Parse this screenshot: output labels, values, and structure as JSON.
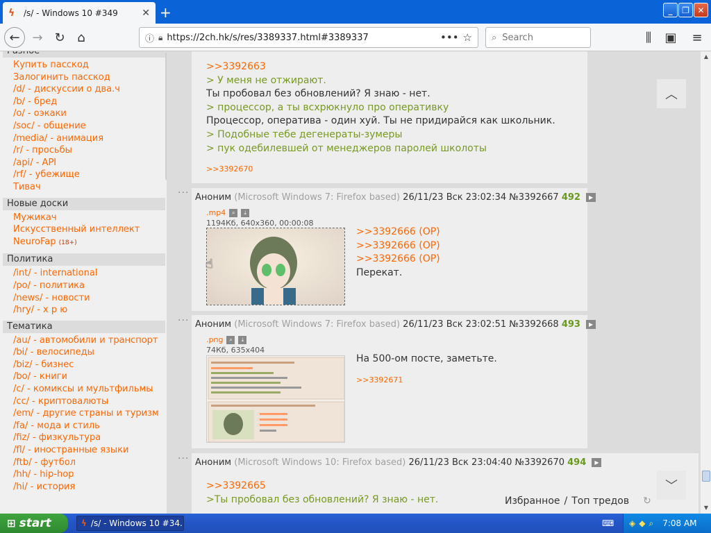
{
  "browser": {
    "tab_title": "/s/ - Windows 10 #349",
    "tab_close": "✕",
    "new_tab": "+",
    "url": "https://2ch.hk/s/res/3389337.html#3389337",
    "search_placeholder": "Search",
    "window_min": "_",
    "window_max": "❐",
    "window_close": "✕"
  },
  "sidebar": {
    "sections": [
      {
        "title": "Разное",
        "items": [
          "Купить пасскод",
          "Залогинить пасскод",
          "/d/ - дискуссии о два.ч",
          "/b/ - бред",
          "/o/ - оэкаки",
          "/soc/ - общение",
          "/media/ - анимация",
          "/r/ - просьбы",
          "/api/ - API",
          "/rf/ - убежище",
          "Тивач"
        ]
      },
      {
        "title": "Новые доски",
        "items": [
          "Мужикач",
          "Искусственный интеллект",
          "NeuroFap"
        ],
        "badge": "(18+)"
      },
      {
        "title": "Политика",
        "items": [
          "/int/ - international",
          "/po/ - политика",
          "/news/ - новости",
          "/hry/ - х р ю"
        ]
      },
      {
        "title": "Тематика",
        "items": [
          "/au/ - автомобили и транспорт",
          "/bi/ - велосипеды",
          "/biz/ - бизнес",
          "/bo/ - книги",
          "/c/ - комиксы и мультфильмы",
          "/cc/ - криптовалюты",
          "/em/ - другие страны и туризм",
          "/fa/ - мода и стиль",
          "/fiz/ - физкультура",
          "/fl/ - иностранные языки",
          "/ftb/ - футбол",
          "/hh/ - hip-hop",
          "/hi/ - история"
        ]
      }
    ]
  },
  "posts": {
    "p0": {
      "lines": [
        {
          "kind": "ref",
          "text": ">>3392663"
        },
        {
          "kind": "quote",
          "text": "> У меня не отжирают."
        },
        {
          "kind": "text",
          "text": "Ты пробовал без обновлений? Я знаю - нет."
        },
        {
          "kind": "quote",
          "text": "> процессор, а ты всхрюкнуло про оперативку"
        },
        {
          "kind": "text",
          "text": "Процессор, оператива - один хуй. Ты не придирайся как школьник."
        },
        {
          "kind": "quote",
          "text": "> Подобные тебе дегенераты-зумеры"
        },
        {
          "kind": "quote",
          "text": "> пук одебилевшей от менеджеров паролей школоты"
        }
      ],
      "reply": ">>3392670"
    },
    "p1": {
      "dots": "···",
      "name": "Аноним",
      "os": "(Microsoft Windows 7: Firefox based)",
      "date": "26/11/23 Вск 23:02:34",
      "num": "№3392667",
      "count": "492",
      "file_ext": ".mp4",
      "file_info": "1194Кб, 640x360, 00:00:08",
      "lines": [
        {
          "kind": "ref",
          "text": ">>3392666 (OP)"
        },
        {
          "kind": "ref",
          "text": ">>3392666 (OP)"
        },
        {
          "kind": "ref",
          "text": ">>3392666 (OP)"
        },
        {
          "kind": "text",
          "text": "Перекат."
        }
      ]
    },
    "p2": {
      "dots": "···",
      "name": "Аноним",
      "os": "(Microsoft Windows 7: Firefox based)",
      "date": "26/11/23 Вск 23:02:51",
      "num": "№3392668",
      "count": "493",
      "file_ext": ".png",
      "file_info": "74Кб, 635x404",
      "lines": [
        {
          "kind": "text",
          "text": "На 500-ом посте, заметьте."
        }
      ],
      "reply": ">>3392671"
    },
    "p3": {
      "dots": "···",
      "name": "Аноним",
      "os": "(Microsoft Windows 10: Firefox based)",
      "date": "26/11/23 Вск 23:04:40",
      "num": "№3392670",
      "count": "494",
      "lines": [
        {
          "kind": "ref",
          "text": ">>3392665"
        },
        {
          "kind": "quote",
          "text": ">Ты пробовал без обновлений? Я знаю - нет."
        }
      ]
    }
  },
  "bottom_nav": {
    "favorites": "Избранное",
    "sep": "/",
    "top": "Топ тредов"
  },
  "taskbar": {
    "start": "start",
    "item": "/s/ - Windows 10 #34...",
    "time": "7:08 AM"
  },
  "colors": {
    "link": "#ff6600",
    "quote": "#789922",
    "accent": "#0a64d8"
  },
  "icons": [
    "firefox-tab-icon",
    "back-icon",
    "forward-icon",
    "reload-icon",
    "home-icon",
    "info-icon",
    "lock-icon",
    "dots-icon",
    "star-icon",
    "search-icon",
    "library-icon",
    "sidebar-icon",
    "menu-icon",
    "search-image-icon",
    "download-icon",
    "play-icon",
    "scroll-up-icon",
    "scroll-down-icon",
    "refresh-icon",
    "windows-flag-icon"
  ]
}
